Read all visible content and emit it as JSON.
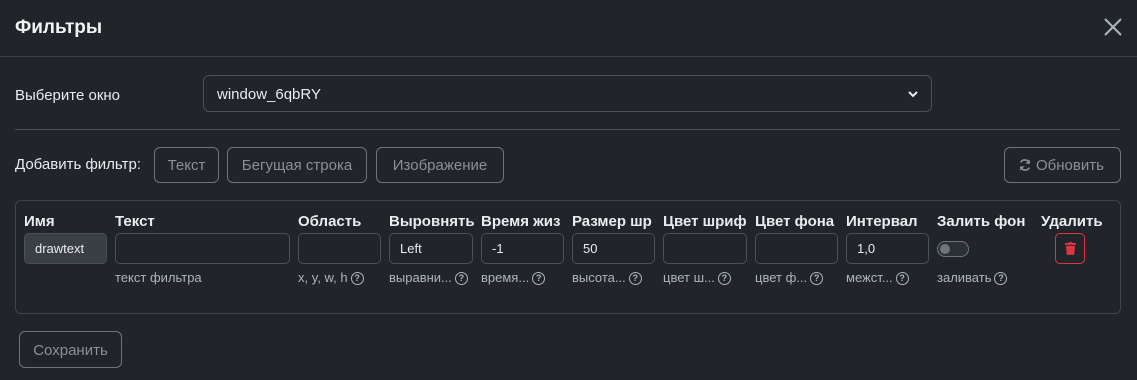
{
  "dialog": {
    "title": "Фильтры"
  },
  "window_select": {
    "label": "Выберите окно",
    "value": "window_6qbRY"
  },
  "add_filter": {
    "label": "Добавить фильтр:",
    "buttons": [
      "Текст",
      "Бегущая строка",
      "Изображение"
    ],
    "refresh_label": "Обновить"
  },
  "columns": [
    "Имя",
    "Текст",
    "Область",
    "Выровнять",
    "Время жиз",
    "Размер шр",
    "Цвет шриф",
    "Цвет фона",
    "Интервал",
    "Залить фон",
    "Удалить"
  ],
  "filter_row": {
    "name": "drawtext",
    "text": "",
    "area": "",
    "align": "Left",
    "lifetime": "-1",
    "font_size": "50",
    "font_color": "",
    "bg_color": "",
    "interval": "1,0",
    "fill_bg": false
  },
  "help": {
    "text": "текст фильтра",
    "area": "x, y, w, h",
    "align": "выравни...",
    "lifetime": "время...",
    "font_size": "высота...",
    "font_color": "цвет ш...",
    "bg_color": "цвет ф...",
    "interval": "межст...",
    "fill_bg": "заливать"
  },
  "save_label": "Сохранить",
  "colors": {
    "background": "#212529",
    "border": "#495057",
    "danger": "#dc3545",
    "muted": "#6c757d"
  },
  "icons": [
    "close-icon",
    "chevron-down-icon",
    "refresh-icon",
    "help-icon",
    "trash-icon"
  ]
}
